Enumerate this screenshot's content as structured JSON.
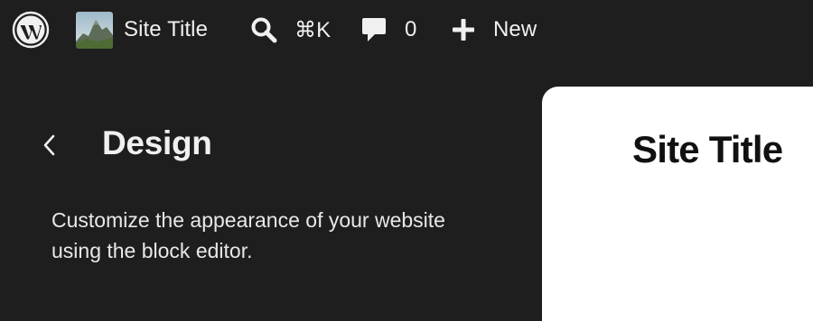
{
  "admin_bar": {
    "site_title": "Site Title",
    "search_shortcut": "⌘K",
    "comments_count": "0",
    "new_label": "New",
    "icons": {
      "logo": "wordpress-logo-icon",
      "site": "site-thumbnail",
      "search": "search-icon",
      "comments": "comment-bubble-icon",
      "new": "plus-icon"
    }
  },
  "sidebar": {
    "back_icon": "chevron-left-icon",
    "title": "Design",
    "description": "Customize the appearance of your website using the block editor."
  },
  "preview": {
    "site_title": "Site Title"
  },
  "colors": {
    "background": "#1e1e1e",
    "text": "#f0f0f0",
    "canvas": "#ffffff",
    "canvas_text": "#111111"
  }
}
